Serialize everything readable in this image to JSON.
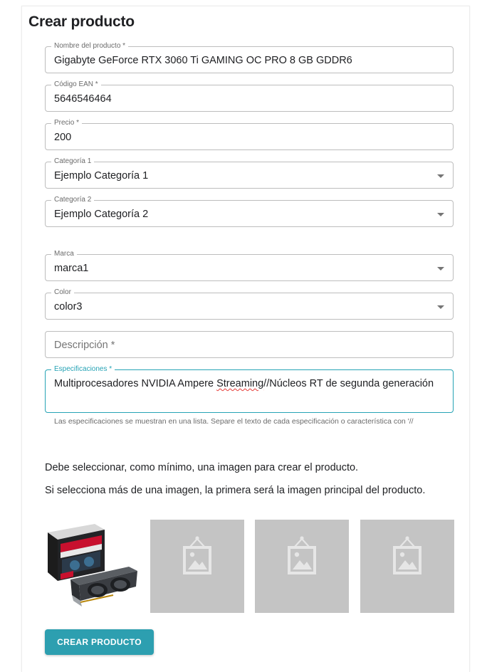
{
  "page": {
    "title": "Crear producto"
  },
  "form": {
    "nombre": {
      "label": "Nombre del producto *",
      "value": "Gigabyte GeForce RTX 3060 Ti GAMING OC PRO 8 GB GDDR6"
    },
    "ean": {
      "label": "Código EAN *",
      "value": "5646546464"
    },
    "precio": {
      "label": "Precio *",
      "value": "200"
    },
    "categoria1": {
      "label": "Categoría 1",
      "value": "Ejemplo Categoría 1"
    },
    "categoria2": {
      "label": "Categoría 2",
      "value": "Ejemplo Categoría 2"
    },
    "marca": {
      "label": "Marca",
      "value": "marca1"
    },
    "color": {
      "label": "Color",
      "value": "color3"
    },
    "descripcion": {
      "placeholder": "Descripción *"
    },
    "especificaciones": {
      "label": "Especificaciones *",
      "value_before": "Multiprocesadores NVIDIA Ampere ",
      "value_misspelled": "Streaming",
      "value_after": "//Núcleos RT de segunda generación",
      "helper": "Las especificaciones se muestran en una lista. Separe el texto de cada especificación o característica con '//"
    }
  },
  "images": {
    "note1": "Debe seleccionar, como mínimo, una imagen para crear el producto.",
    "note2": "Si selecciona más de una imagen, la primera será la imagen principal del producto.",
    "slots": [
      {
        "name": "product-photo",
        "icon": "graphics-card-photo"
      },
      {
        "name": "image-placeholder",
        "icon": "image-placeholder-icon"
      },
      {
        "name": "image-placeholder",
        "icon": "image-placeholder-icon"
      },
      {
        "name": "image-placeholder",
        "icon": "image-placeholder-icon"
      }
    ]
  },
  "actions": {
    "create_label": "CREAR PRODUCTO"
  },
  "colors": {
    "accent": "#2d9fb0",
    "focus_border": "#26a3b5",
    "placeholder_bg": "#c4c4c4"
  }
}
